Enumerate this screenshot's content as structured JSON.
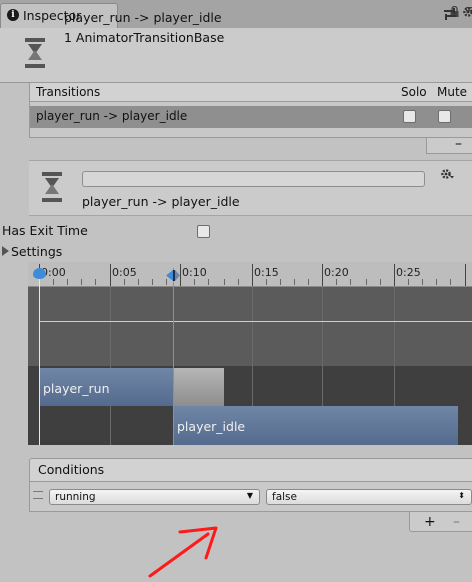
{
  "tab": {
    "label": "Inspector",
    "info_glyph": "i"
  },
  "header": {
    "title": "player_run -> player_idle",
    "subtitle": "1 AnimatorTransitionBase"
  },
  "transitions": {
    "header_label": "Transitions",
    "solo_label": "Solo",
    "mute_label": "Mute",
    "rows": [
      {
        "label": "player_run -> player_idle",
        "solo": false,
        "mute": false
      }
    ],
    "remove_label": "–"
  },
  "sub_panel": {
    "name_value": "",
    "label": "player_run -> player_idle"
  },
  "has_exit_time": {
    "label": "Has Exit Time",
    "checked": false
  },
  "settings": {
    "label": "Settings"
  },
  "timeline": {
    "ticks": [
      "0:00",
      "0:05",
      "0:10",
      "0:15",
      "0:20",
      "0:25"
    ],
    "clip_from": "player_run",
    "clip_to": "player_idle"
  },
  "conditions": {
    "header_label": "Conditions",
    "rows": [
      {
        "parameter": "running",
        "value": "false"
      }
    ],
    "add_label": "+",
    "remove_label": "–"
  },
  "colors": {
    "panel": "#c2c2c2",
    "clip_bar": "#6f86a7",
    "annotation_arrow": "#ff1a1a"
  }
}
